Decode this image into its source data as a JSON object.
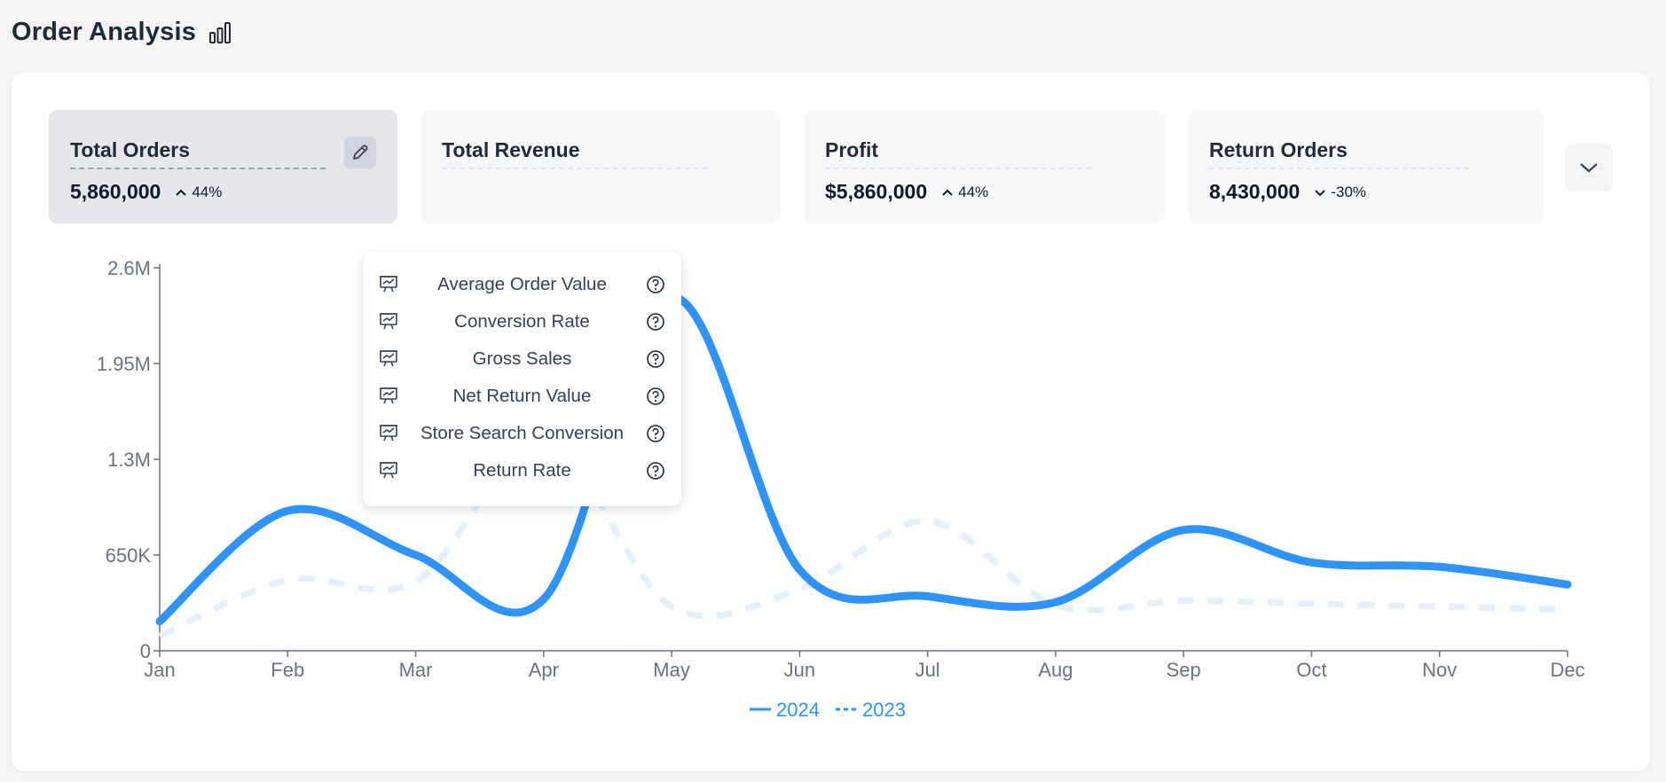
{
  "header": {
    "title": "Order Analysis",
    "icon": "bar-chart-icon"
  },
  "kpis": [
    {
      "label": "Total Orders",
      "value": "5,860,000",
      "delta": "44%",
      "direction": "up",
      "active": true
    },
    {
      "label": "Total Revenue",
      "value": "",
      "delta": "",
      "direction": "",
      "active": false
    },
    {
      "label": "Profit",
      "value": "$5,860,000",
      "delta": "44%",
      "direction": "up",
      "active": false
    },
    {
      "label": "Return Orders",
      "value": "8,430,000",
      "delta": "-30%",
      "direction": "down",
      "active": false
    }
  ],
  "dropdown": {
    "items": [
      {
        "label": "Average Order Value"
      },
      {
        "label": "Conversion Rate"
      },
      {
        "label": "Gross Sales"
      },
      {
        "label": "Net Return Value"
      },
      {
        "label": "Store Search Conversion"
      },
      {
        "label": "Return Rate"
      }
    ]
  },
  "chart_data": {
    "type": "line",
    "x": [
      "Jan",
      "Feb",
      "Mar",
      "Apr",
      "May",
      "Jun",
      "Jul",
      "Aug",
      "Sep",
      "Oct",
      "Nov",
      "Dec"
    ],
    "y_ticks": [
      "0",
      "650K",
      "1.3M",
      "1.95M",
      "2.6M"
    ],
    "ylim": [
      0,
      2600000
    ],
    "grid": false,
    "legend_position": "bottom-center",
    "series": [
      {
        "name": "2024",
        "style": "solid",
        "color": "#2e93fa",
        "values": [
          200000,
          950000,
          650000,
          350000,
          2400000,
          550000,
          370000,
          330000,
          820000,
          600000,
          570000,
          450000
        ]
      },
      {
        "name": "2023",
        "style": "dashed",
        "color": "#e6f0fd",
        "values": [
          100000,
          480000,
          470000,
          1420000,
          300000,
          420000,
          880000,
          310000,
          340000,
          320000,
          300000,
          280000
        ]
      }
    ]
  }
}
